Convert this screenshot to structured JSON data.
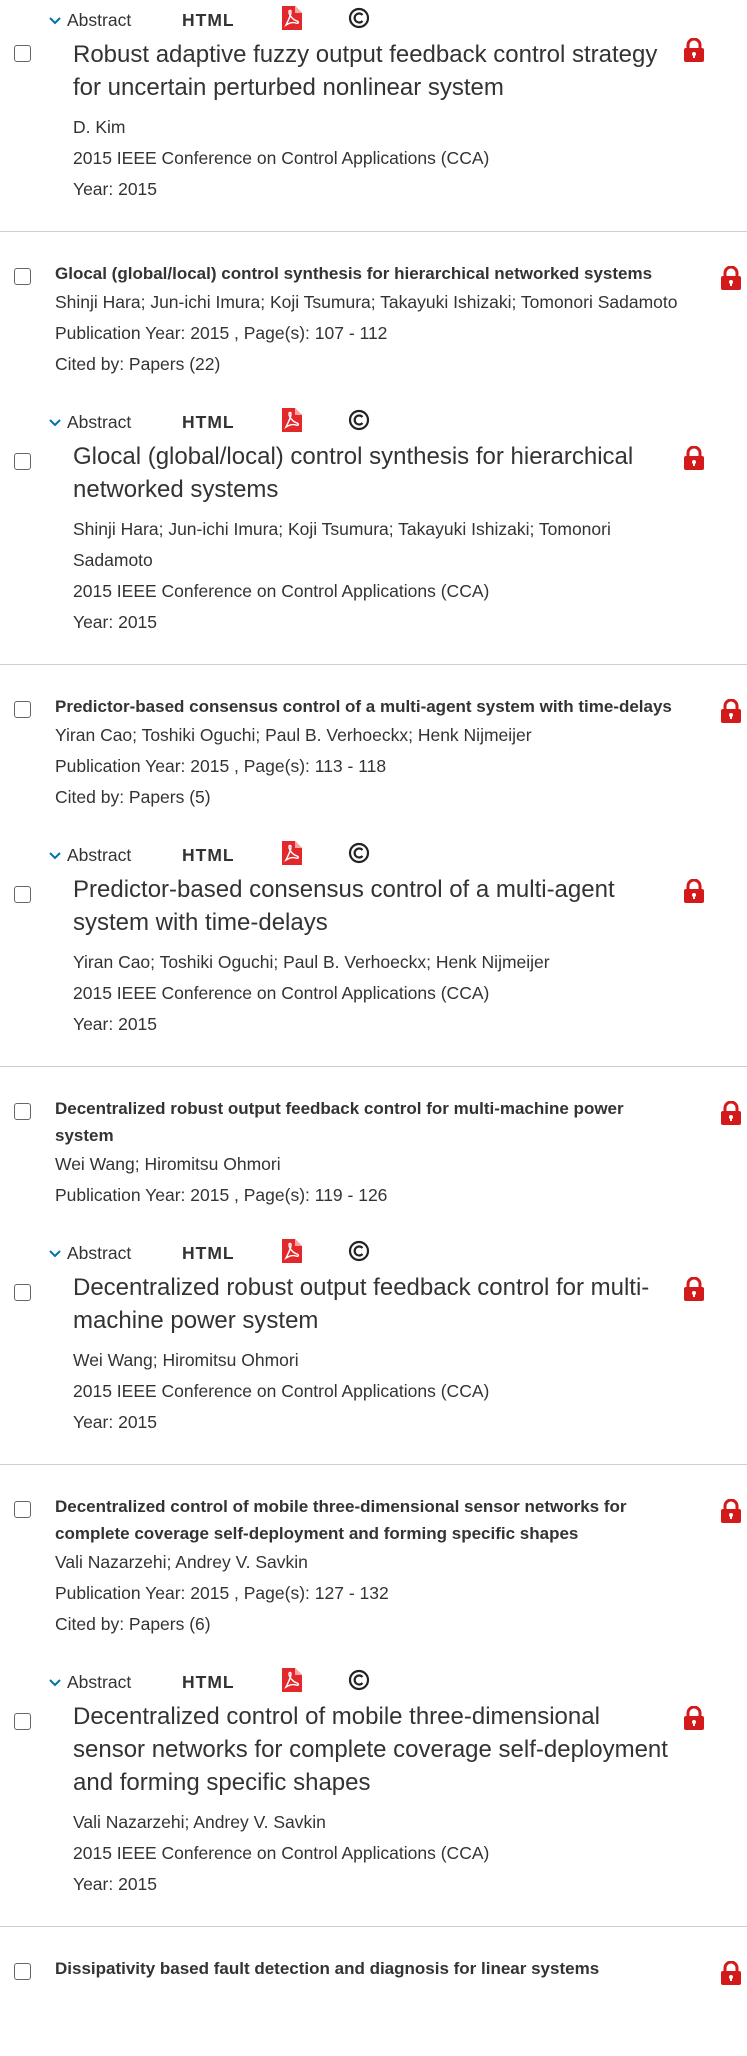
{
  "icons": {
    "lock": "lock-icon",
    "pdf": "pdf-icon",
    "copyright": "copyright-icon",
    "chevron": "chevron-down-icon"
  },
  "colors": {
    "lock": "#d4191a",
    "pdf": "#e3282c",
    "link": "#0073a8",
    "divider": "#cfcfcf"
  },
  "tool_labels": {
    "abstract": "Abstract",
    "html": "HTML"
  },
  "entries": [
    {
      "sub": {
        "title": "Robust adaptive fuzzy output feedback control strategy for uncertain perturbed nonlinear system",
        "authors": "D. Kim",
        "conference": "2015 IEEE Conference on Control Applications (CCA)",
        "year": "Year: 2015"
      }
    },
    {
      "main": {
        "title": "Glocal (global/local) control synthesis for hierarchical networked systems",
        "authors": "Shinji Hara; Jun-ichi Imura; Koji Tsumura; Takayuki Ishizaki; Tomonori Sadamoto",
        "pubinfo": "Publication Year: 2015 , Page(s): 107  -  112",
        "cited": "Cited by: Papers (22)"
      },
      "sub": {
        "title": "Glocal (global/local) control synthesis for hierarchical networked systems",
        "authors": "Shinji Hara; Jun-ichi Imura; Koji Tsumura; Takayuki Ishizaki; Tomonori Sadamoto",
        "conference": "2015 IEEE Conference on Control Applications (CCA)",
        "year": "Year: 2015"
      }
    },
    {
      "main": {
        "title": "Predictor-based consensus control of a multi-agent system with time-delays",
        "authors": "Yiran Cao; Toshiki Oguchi; Paul B. Verhoeckx; Henk Nijmeijer",
        "pubinfo": "Publication Year: 2015 , Page(s): 113  -  118",
        "cited": "Cited by: Papers (5)"
      },
      "sub": {
        "title": "Predictor-based consensus control of a multi-agent system with time-delays",
        "authors": "Yiran Cao; Toshiki Oguchi; Paul B. Verhoeckx; Henk Nijmeijer",
        "conference": "2015 IEEE Conference on Control Applications (CCA)",
        "year": "Year: 2015"
      }
    },
    {
      "main": {
        "title": "Decentralized robust output feedback control for multi-machine power system",
        "authors": "Wei Wang; Hiromitsu Ohmori",
        "pubinfo": "Publication Year: 2015 , Page(s): 119  -  126"
      },
      "sub": {
        "title": "Decentralized robust output feedback control for multi-machine power system",
        "authors": "Wei Wang; Hiromitsu Ohmori",
        "conference": "2015 IEEE Conference on Control Applications (CCA)",
        "year": "Year: 2015"
      }
    },
    {
      "main": {
        "title": "Decentralized control of mobile three-dimensional sensor networks for complete coverage self-deployment and forming specific shapes",
        "authors": "Vali Nazarzehi; Andrey V. Savkin",
        "pubinfo": "Publication Year: 2015 , Page(s): 127  -  132",
        "cited": "Cited by: Papers (6)"
      },
      "sub": {
        "title": "Decentralized control of mobile three-dimensional sensor networks for complete coverage self-deployment and forming specific shapes",
        "authors": "Vali Nazarzehi; Andrey V. Savkin",
        "conference": "2015 IEEE Conference on Control Applications (CCA)",
        "year": "Year: 2015"
      }
    },
    {
      "main": {
        "title": "Dissipativity based fault detection and diagnosis for linear systems"
      }
    }
  ]
}
